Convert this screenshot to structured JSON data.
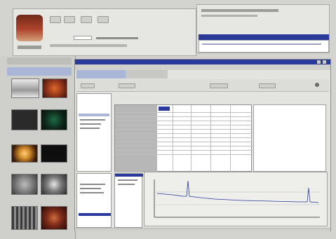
{
  "colors": {
    "desktop_gray": "#d3d3cf",
    "panel_gray": "#e6e6e2",
    "title_blue": "#2a3a9b",
    "light_blue": "#a9b6d8",
    "accent_red": "#b0442c"
  },
  "icons": {
    "app_logo": "image-viewer-logo-icon",
    "close": "close-icon",
    "minimize": "minimize-icon",
    "maximize": "maximize-icon"
  },
  "thumbnails": [
    {
      "name": "thumb-1",
      "color": "#d6d6d6"
    },
    {
      "name": "thumb-2",
      "color": "#9b3a1d"
    },
    {
      "name": "thumb-3",
      "color": "#2a2a2a"
    },
    {
      "name": "thumb-4",
      "color": "#0e2a1c"
    },
    {
      "name": "thumb-5",
      "color": "#cf8a2a"
    },
    {
      "name": "thumb-6",
      "color": "#0e0e0e"
    },
    {
      "name": "thumb-7",
      "color": "#8a8a8a"
    },
    {
      "name": "thumb-8",
      "color": "#444444"
    },
    {
      "name": "thumb-9",
      "color": "#6a6a6a"
    },
    {
      "name": "thumb-10",
      "color": "#7a2a1a"
    }
  ],
  "table": {
    "columns": [
      "",
      "",
      "",
      "",
      "",
      ""
    ],
    "rows": 14
  }
}
